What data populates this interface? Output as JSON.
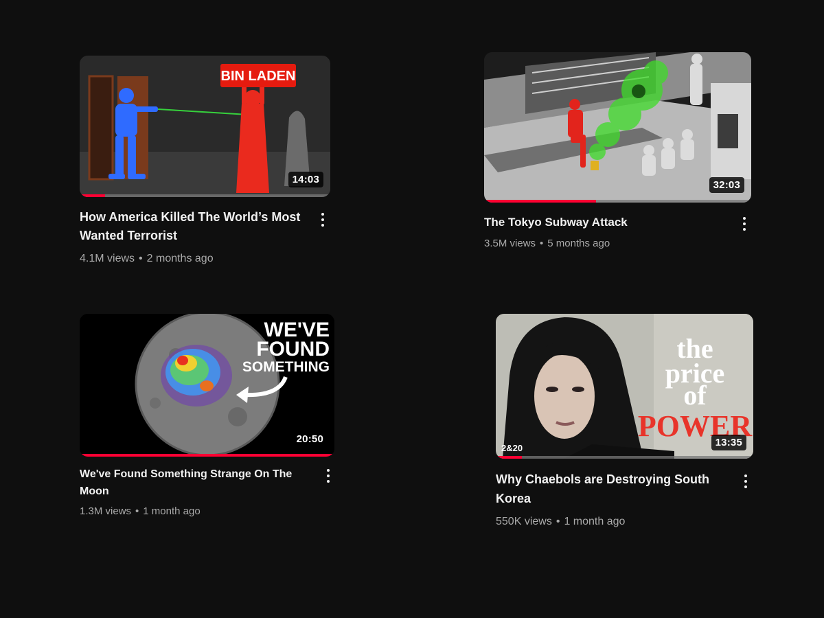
{
  "videos": [
    {
      "title": "How America Killed The World’s Most Wanted Terrorist",
      "views": "4.1M views",
      "separator": "•",
      "age": "2 months ago",
      "duration": "14:03",
      "watched_fraction": 0.1,
      "thumbnail_text": "BIN LADEN",
      "thumbnail_icon": "soldier-aiming-at-figure"
    },
    {
      "title": "The Tokyo Subway Attack",
      "views": "3.5M views",
      "separator": "•",
      "age": "5 months ago",
      "duration": "32:03",
      "watched_fraction": 0.42,
      "thumbnail_icon": "subway-car-toxic-gas"
    },
    {
      "title": "We've Found Something Strange On The Moon",
      "views": "1.3M views",
      "separator": "•",
      "age": "1 month ago",
      "duration": "20:50",
      "watched_fraction": 1.0,
      "thumbnail_text": [
        "WE'VE",
        "FOUND",
        "SOMETHING"
      ],
      "thumbnail_icon": "moon-heatmap"
    },
    {
      "title": "Why Chaebols are Destroying South Korea",
      "views": "550K views",
      "separator": "•",
      "age": "1 month ago",
      "duration": "13:35",
      "watched_fraction": 0.1,
      "thumbnail_text": [
        "the",
        "price",
        "of",
        "POWER"
      ],
      "thumbnail_badge": "2&20",
      "thumbnail_icon": "portrait-woman"
    }
  ],
  "colors": {
    "background": "#0f0f0f",
    "title": "#f1f1f1",
    "meta": "#aaaaaa",
    "progress": "#ff0033"
  }
}
